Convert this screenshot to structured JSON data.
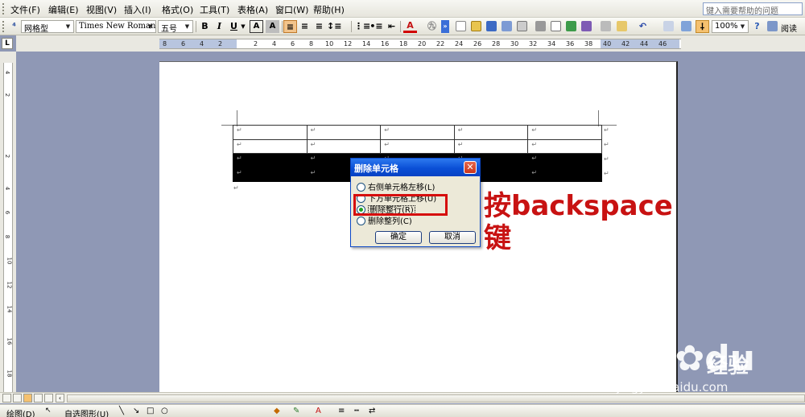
{
  "menubar": {
    "items": [
      "文件(F)",
      "编辑(E)",
      "视图(V)",
      "插入(I)",
      "格式(O)",
      "工具(T)",
      "表格(A)",
      "窗口(W)",
      "帮助(H)"
    ],
    "help_placeholder": "键入需要帮助的问题"
  },
  "toolbar": {
    "style": "网格型",
    "font": "Times New Roman",
    "size": "五号",
    "bold": "B",
    "italic": "I",
    "underline": "U",
    "char_border": "A",
    "char_shade": "A",
    "font_color": "A",
    "zoom": "100%",
    "read_label": "阅读"
  },
  "ruler": {
    "corner": "L",
    "left_ticks": [
      "8",
      "6",
      "4",
      "2"
    ],
    "right_ticks": [
      "2",
      "4",
      "6",
      "8",
      "10",
      "12",
      "14",
      "16",
      "18",
      "20",
      "22",
      "24",
      "26",
      "28",
      "30",
      "32",
      "34",
      "36",
      "38",
      "40",
      "42",
      "44",
      "46",
      "48"
    ],
    "vertical_ticks": [
      "4",
      "2",
      "2",
      "4",
      "6",
      "8",
      "10",
      "12",
      "14",
      "16",
      "18"
    ]
  },
  "table": {
    "mark": "↵",
    "rows": 4,
    "cols": 5,
    "selected_rows": [
      2,
      3
    ]
  },
  "dialog": {
    "title": "删除单元格",
    "close": "✕",
    "options": [
      "右侧单元格左移(L)",
      "下方单元格上移(U)",
      "删除整行(R)",
      "删除整列(C)"
    ],
    "selected_index": 2,
    "ok": "确定",
    "cancel": "取消"
  },
  "annotation": {
    "line1": "按backspace",
    "line2": "键"
  },
  "drawbar": {
    "draw": "绘图(D)",
    "autoshapes": "自选图形(U)"
  },
  "watermark": {
    "logo": "Bai",
    "logo2": "du",
    "text": "经验",
    "url": "jingyan.baidu.com"
  }
}
